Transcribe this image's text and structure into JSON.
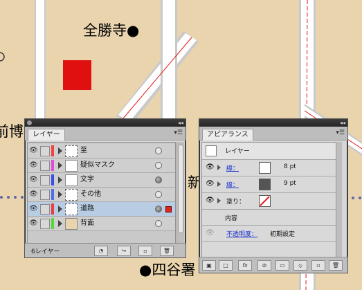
{
  "map": {
    "labels": {
      "zenshoji": "全勝寺●",
      "hakubutsu": "前博物",
      "yotsuya": "●四谷署",
      "shin": "新"
    },
    "colors": {
      "background": "#e9d4ae",
      "road": "#ffffff",
      "road_edge": "#c9c9c9",
      "center_line": "#e01717",
      "red_square": "#e01010",
      "railway_dots": "#5c67a8"
    }
  },
  "layers_panel": {
    "tab_label": "レイヤー",
    "menu_icon": "panel-menu-icon",
    "collapse_icon": "collapse-icon",
    "layers": [
      {
        "name": "至",
        "color": "#ee4444",
        "thumb": "dashed",
        "target": "empty",
        "selected": false
      },
      {
        "name": "疑似マスク",
        "color": "#e24bd8",
        "thumb": "blank",
        "target": "empty",
        "selected": false
      },
      {
        "name": "文字",
        "color": "#3a4fe8",
        "thumb": "blank",
        "target": "filled",
        "selected": false
      },
      {
        "name": "その他",
        "color": "#4f6ee8",
        "thumb": "dashed",
        "target": "empty",
        "selected": false
      },
      {
        "name": "道路",
        "color": "#ee3b3b",
        "thumb": "dashed",
        "target": "filled",
        "selected": true
      },
      {
        "name": "背面",
        "color": "#55d83a",
        "thumb": "beige",
        "target": "empty",
        "selected": false
      }
    ],
    "footer_label": "6レイヤー",
    "footer_buttons": [
      "make-clip-mask-icon",
      "new-sublayer-icon",
      "new-layer-icon",
      "trash-icon"
    ]
  },
  "appearance_panel": {
    "tab_label": "アピアランス",
    "header_label": "レイヤー",
    "rows": [
      {
        "label": "線：",
        "value": "8 pt",
        "swatch": "#ffffff",
        "kind": "stroke"
      },
      {
        "label": "線：",
        "value": "9 pt",
        "swatch": "#555555",
        "kind": "stroke"
      },
      {
        "label": "塗り：",
        "value": "",
        "swatch": "none",
        "kind": "fill"
      }
    ],
    "content_label": "内容",
    "opacity_label": "不透明度：",
    "opacity_value": "初期設定",
    "footer_buttons": [
      "new-stroke-icon",
      "new-fill-icon",
      "fx",
      "clear-appearance-icon",
      "reduce-basic-icon",
      "no-icon",
      "duplicate-icon",
      "trash-icon"
    ],
    "footer_fx": "fx"
  }
}
